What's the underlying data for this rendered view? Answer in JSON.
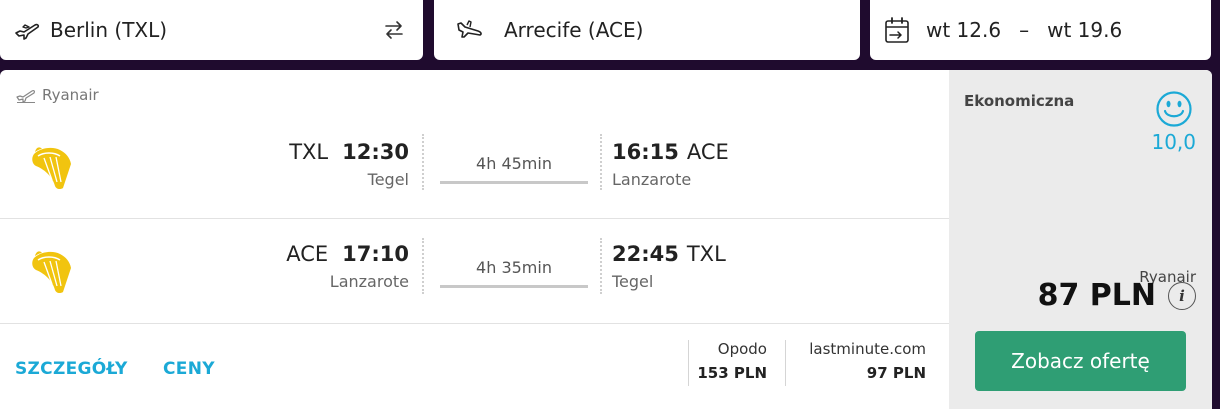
{
  "search": {
    "origin": "Berlin (TXL)",
    "destination": "Arrecife (ACE)",
    "date_out": "wt 12.6",
    "date_sep": "–",
    "date_back": "wt 19.6"
  },
  "result": {
    "carrier_label": "Ryanair",
    "legs": [
      {
        "dep_code": "TXL",
        "dep_time": "12:30",
        "dep_city": "Tegel",
        "duration": "4h 45min",
        "arr_time": "16:15",
        "arr_code": "ACE",
        "arr_city": "Lanzarote"
      },
      {
        "dep_code": "ACE",
        "dep_time": "17:10",
        "dep_city": "Lanzarote",
        "duration": "4h 35min",
        "arr_time": "22:45",
        "arr_code": "TXL",
        "arr_city": "Tegel"
      }
    ],
    "tabs": {
      "details": "SZCZEGÓŁY",
      "prices": "CENY"
    },
    "providers": [
      {
        "name": "Opodo",
        "price": "153 PLN"
      },
      {
        "name": "lastminute.com",
        "price": "97 PLN"
      }
    ],
    "cabin": "Ekonomiczna",
    "score": "10,0",
    "selected_airline": "Ryanair",
    "price": "87 PLN",
    "info_glyph": "i",
    "cta": "Zobacz ofertę"
  },
  "colors": {
    "background": "#1f0b2e",
    "accent": "#1ba9d6",
    "cta": "#2f9e74",
    "logo": "#f1c40f"
  },
  "icons": {
    "origin": "plane-takeoff-icon",
    "swap": "swap-arrows-icon",
    "destination": "plane-landing-icon",
    "calendar": "calendar-icon",
    "carrier": "plane-takeoff-icon",
    "logo": "ryanair-harp-logo",
    "rating": "smiley-icon",
    "info": "info-icon"
  }
}
